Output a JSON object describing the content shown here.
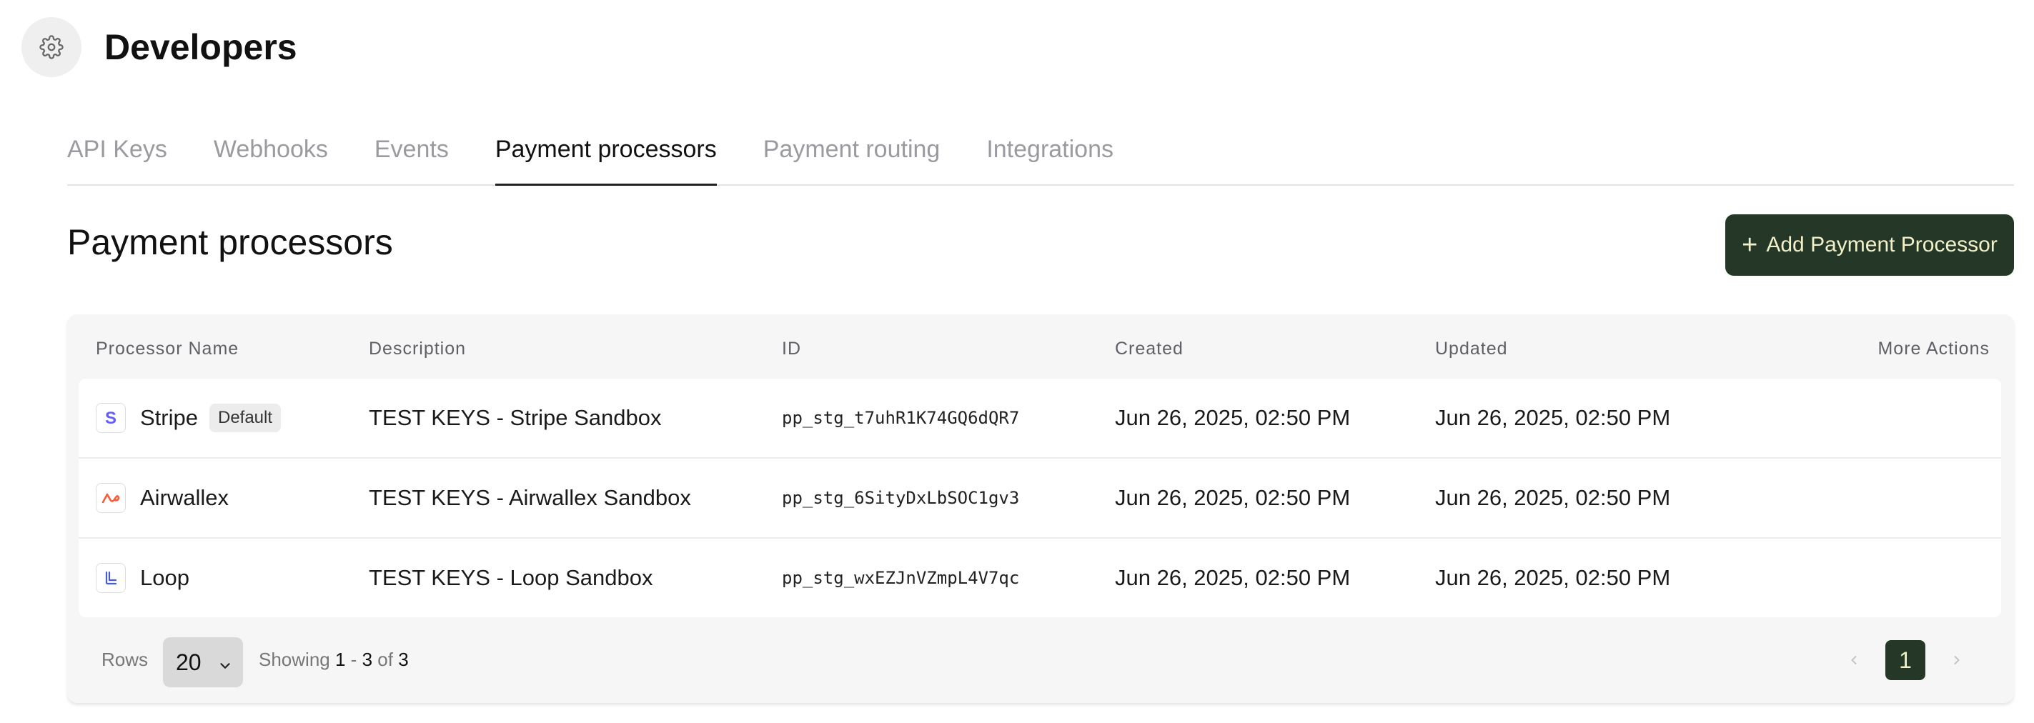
{
  "header": {
    "title": "Developers",
    "icon": "gear-icon"
  },
  "tabs": [
    {
      "label": "API Keys",
      "active": false
    },
    {
      "label": "Webhooks",
      "active": false
    },
    {
      "label": "Events",
      "active": false
    },
    {
      "label": "Payment processors",
      "active": true
    },
    {
      "label": "Payment routing",
      "active": false
    },
    {
      "label": "Integrations",
      "active": false
    }
  ],
  "section": {
    "title": "Payment processors",
    "add_button_label": "Add Payment Processor"
  },
  "table": {
    "columns": [
      "Processor Name",
      "Description",
      "ID",
      "Created",
      "Updated",
      "More Actions"
    ],
    "rows": [
      {
        "name": "Stripe",
        "badge": "Default",
        "logo": "stripe-logo-icon",
        "description": "TEST KEYS - Stripe Sandbox",
        "id": "pp_stg_t7uhR1K74GQ6dQR7",
        "created": "Jun 26, 2025, 02:50 PM",
        "updated": "Jun 26, 2025, 02:50 PM"
      },
      {
        "name": "Airwallex",
        "badge": "",
        "logo": "airwallex-logo-icon",
        "description": "TEST KEYS - Airwallex Sandbox",
        "id": "pp_stg_6SityDxLbSOC1gv3",
        "created": "Jun 26, 2025, 02:50 PM",
        "updated": "Jun 26, 2025, 02:50 PM"
      },
      {
        "name": "Loop",
        "badge": "",
        "logo": "loop-logo-icon",
        "description": "TEST KEYS - Loop Sandbox",
        "id": "pp_stg_wxEZJnVZmpL4V7qc",
        "created": "Jun 26, 2025, 02:50 PM",
        "updated": "Jun 26, 2025, 02:50 PM"
      }
    ]
  },
  "footer": {
    "rows_label": "Rows",
    "rows_per_page": "20",
    "showing_prefix": "Showing",
    "range_start": "1",
    "range_sep": "-",
    "range_end": "3",
    "of_label": "of",
    "total": "3",
    "current_page": "1"
  },
  "colors": {
    "accent": "#253827",
    "accent_text": "#f1f0c8",
    "stripe": "#635bff",
    "airwallex": "#ff5a36",
    "loop": "#4a5bd6"
  }
}
